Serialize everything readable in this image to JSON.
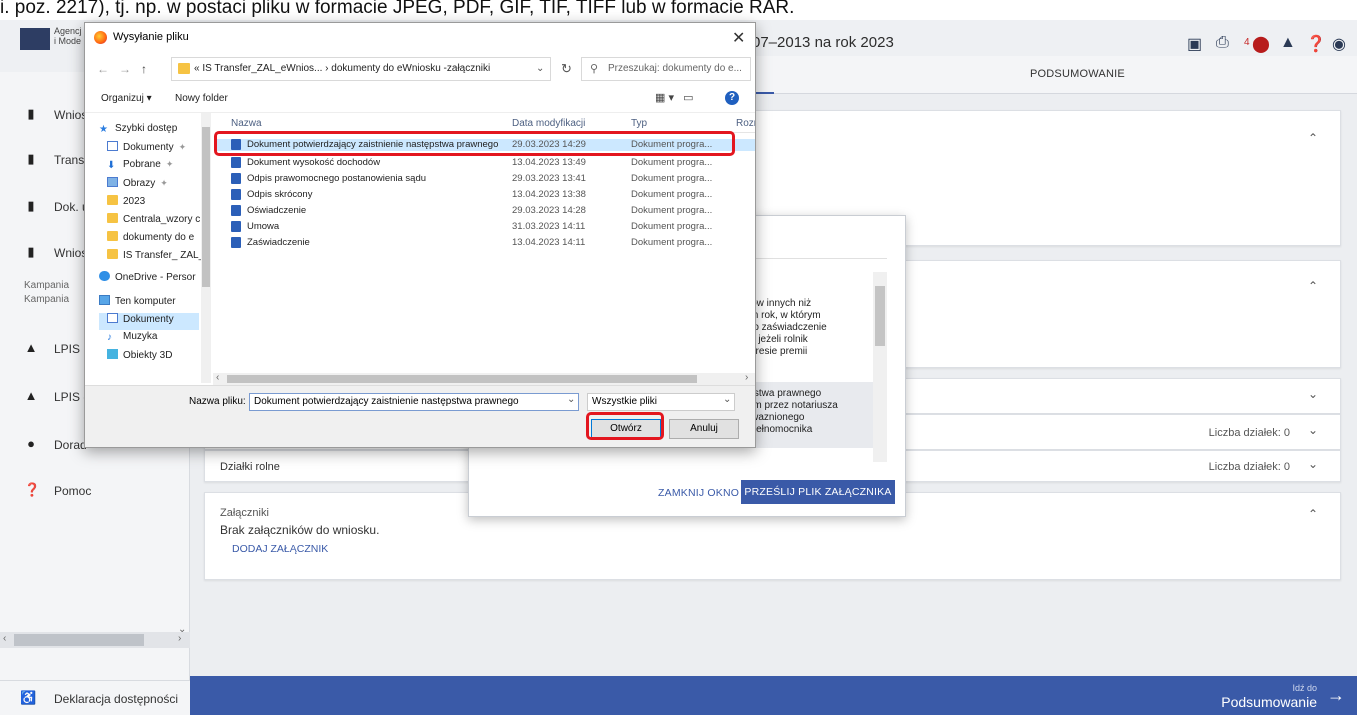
{
  "caption": {
    "text": "i. poz. 2217), tj. np. w postaci pliku w formacie JPEG, PDF, GIF, TIF, TIFF lub w formacie RAR."
  },
  "header": {
    "agency_line1": "Agencj",
    "agency_line2": "i Mode",
    "title": "07–2013 na rok 2023",
    "notification_count": "4"
  },
  "tabs": {
    "summary": "PODSUMOWANIE"
  },
  "sidebar": {
    "items": [
      {
        "label": "Wnios"
      },
      {
        "label": "Transf"
      },
      {
        "label": "Dok. u"
      },
      {
        "label": "Wnios"
      },
      {
        "label": "LPIS"
      },
      {
        "label": "LPIS -"
      },
      {
        "label": "Dorad"
      },
      {
        "label": "Pomoc"
      }
    ],
    "campaign_1": "Kampania",
    "campaign_2": "Kampania",
    "footer": "Deklaracja dostępności"
  },
  "footer_bar": {
    "next_label": "Idź do",
    "next_target": "Podsumowanie"
  },
  "main": {
    "parcels_count_1": "Liczba działek: 0",
    "parcels_count_2": "Liczba działek: 0",
    "farmland_label": "Działki rolne",
    "attachments_title": "Załączniki",
    "attachments_empty": "Brak załączników do wniosku.",
    "add_attachment": "DODAJ ZAŁĄCZNIK"
  },
  "upload_modal": {
    "lines_a": [
      "odów innych niż",
      "cym rok, w którym",
      "albo zaświadczenie",
      "w – jeżeli rolnik",
      "zakresie premii"
    ],
    "lines_b": [
      "tępstwa prawnego",
      "ełem przez notariusza",
      "powaznionego",
      "ie pełnomocnika"
    ],
    "close_button": "ZAMKNIJ OKNO",
    "send_button": "PRZEŚLIJ PLIK ZAŁĄCZNIKA"
  },
  "file_dialog": {
    "title": "Wysyłanie pliku",
    "path": "« IS Transfer_ZAL_eWnios...  ›  dokumenty do eWniosku -załączniki",
    "search_placeholder": "Przeszukaj: dokumenty do e...",
    "organize": "Organizuj ▾",
    "new_folder": "Nowy folder",
    "columns": {
      "name": "Nazwa",
      "date": "Data modyfikacji",
      "type": "Typ",
      "size": "Rozm"
    },
    "nav": [
      {
        "label": "Szybki dostęp",
        "icon": "star"
      },
      {
        "label": "Dokumenty",
        "icon": "doc",
        "pinned": true
      },
      {
        "label": "Pobrane",
        "icon": "down",
        "pinned": true
      },
      {
        "label": "Obrazy",
        "icon": "img",
        "pinned": true
      },
      {
        "label": "2023",
        "icon": "folder"
      },
      {
        "label": "Centrala_wzory c",
        "icon": "folder"
      },
      {
        "label": "dokumenty do e",
        "icon": "folder"
      },
      {
        "label": "IS Transfer_ ZAL_",
        "icon": "folder"
      },
      {
        "label": "OneDrive - Persor",
        "icon": "cloud"
      },
      {
        "label": "Ten komputer",
        "icon": "pc"
      },
      {
        "label": "Dokumenty",
        "icon": "doc",
        "selected": true
      },
      {
        "label": "Muzyka",
        "icon": "music"
      },
      {
        "label": "Obiekty 3D",
        "icon": "3d"
      }
    ],
    "files": [
      {
        "name": "Dokument potwierdzający zaistnienie następstwa prawnego",
        "date": "29.03.2023 14:29",
        "type": "Dokument progra...",
        "selected": true
      },
      {
        "name": "Dokument wysokość dochodów",
        "date": "13.04.2023 13:49",
        "type": "Dokument progra..."
      },
      {
        "name": "Odpis prawomocnego postanowienia sądu",
        "date": "29.03.2023 13:41",
        "type": "Dokument progra..."
      },
      {
        "name": "Odpis skrócony",
        "date": "13.04.2023 13:38",
        "type": "Dokument progra..."
      },
      {
        "name": "Oświadczenie",
        "date": "29.03.2023 14:28",
        "type": "Dokument progra..."
      },
      {
        "name": "Umowa",
        "date": "31.03.2023 14:11",
        "type": "Dokument progra..."
      },
      {
        "name": "Zaświadczenie",
        "date": "13.04.2023 14:11",
        "type": "Dokument progra..."
      }
    ],
    "filename_label": "Nazwa pliku:",
    "filename_value": "Dokument potwierdzający zaistnienie następstwa prawnego",
    "filter_value": "Wszystkie pliki",
    "open_button": "Otwórz",
    "cancel_button": "Anuluj"
  },
  "colors": {
    "accent": "#3a5aa8",
    "highlight": "#e3161f",
    "selection": "#cce8ff"
  }
}
